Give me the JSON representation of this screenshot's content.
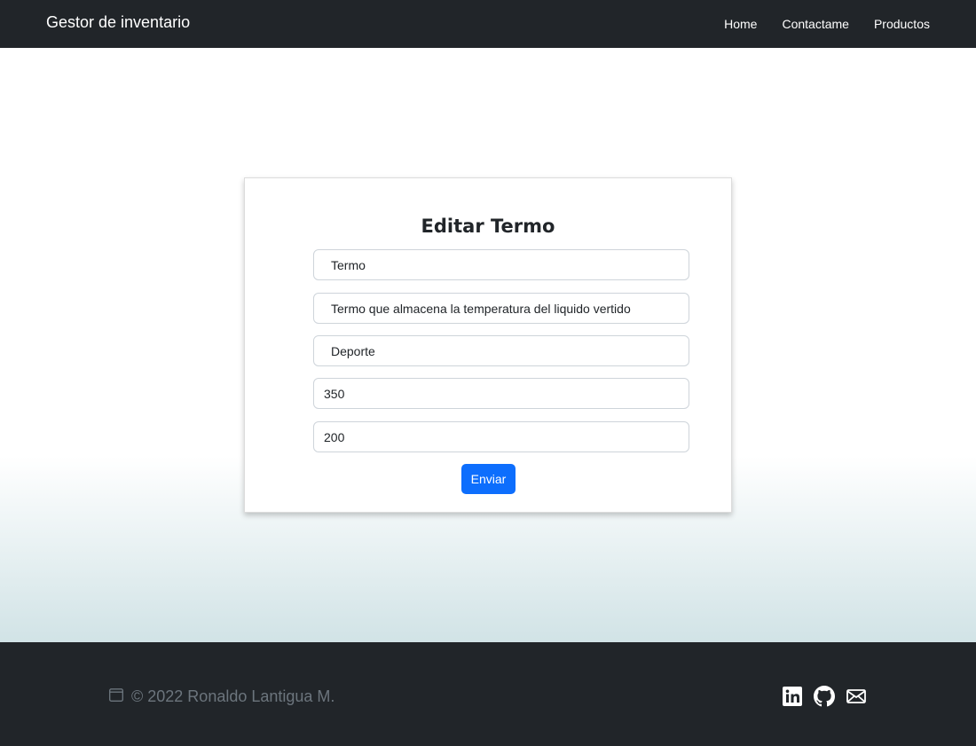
{
  "navbar": {
    "brand": "Gestor de inventario",
    "links": [
      "Home",
      "Contactame",
      "Productos"
    ]
  },
  "form": {
    "title": "Editar Termo",
    "fields": {
      "name": "Termo",
      "description": "Termo que almacena la temperatura del liquido vertido",
      "category": "Deporte",
      "price": "350",
      "stock": "200"
    },
    "submit_label": "Enviar"
  },
  "footer": {
    "copyright": "© 2022 Ronaldo Lantigua M.",
    "icons": [
      "calendar-icon",
      "linkedin-icon",
      "github-icon",
      "envelope-icon"
    ]
  },
  "colors": {
    "navbar_bg": "#212529",
    "button_primary": "#0d6efd",
    "footer_text": "#6c757d"
  }
}
